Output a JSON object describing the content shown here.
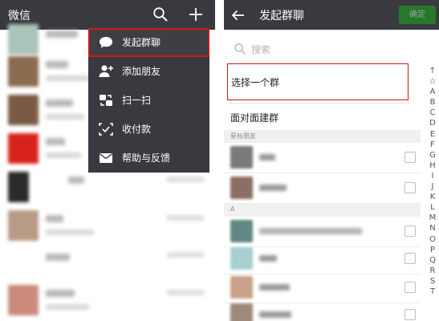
{
  "left": {
    "app_title": "微信",
    "menu": [
      {
        "label": "发起群聊",
        "icon": "chat-bubble-icon",
        "highlight": true
      },
      {
        "label": "添加朋友",
        "icon": "add-friend-icon",
        "highlight": false
      },
      {
        "label": "扫一扫",
        "icon": "scan-icon",
        "highlight": false
      },
      {
        "label": "收付款",
        "icon": "payment-icon",
        "highlight": false
      },
      {
        "label": "帮助与反馈",
        "icon": "mail-icon",
        "highlight": false
      }
    ]
  },
  "right": {
    "title": "发起群聊",
    "confirm_label": "确定",
    "search_placeholder": "搜索",
    "select_group_label": "选择一个群",
    "face_group_label": "面对面建群",
    "starred_header": "星标朋友",
    "section_letter": "A",
    "index_letters": [
      "↑",
      "☆",
      "A",
      "B",
      "C",
      "D",
      "E",
      "F",
      "G",
      "H",
      "I",
      "J",
      "K",
      "L",
      "M",
      "N",
      "O",
      "P",
      "Q",
      "R",
      "S",
      "T"
    ]
  }
}
